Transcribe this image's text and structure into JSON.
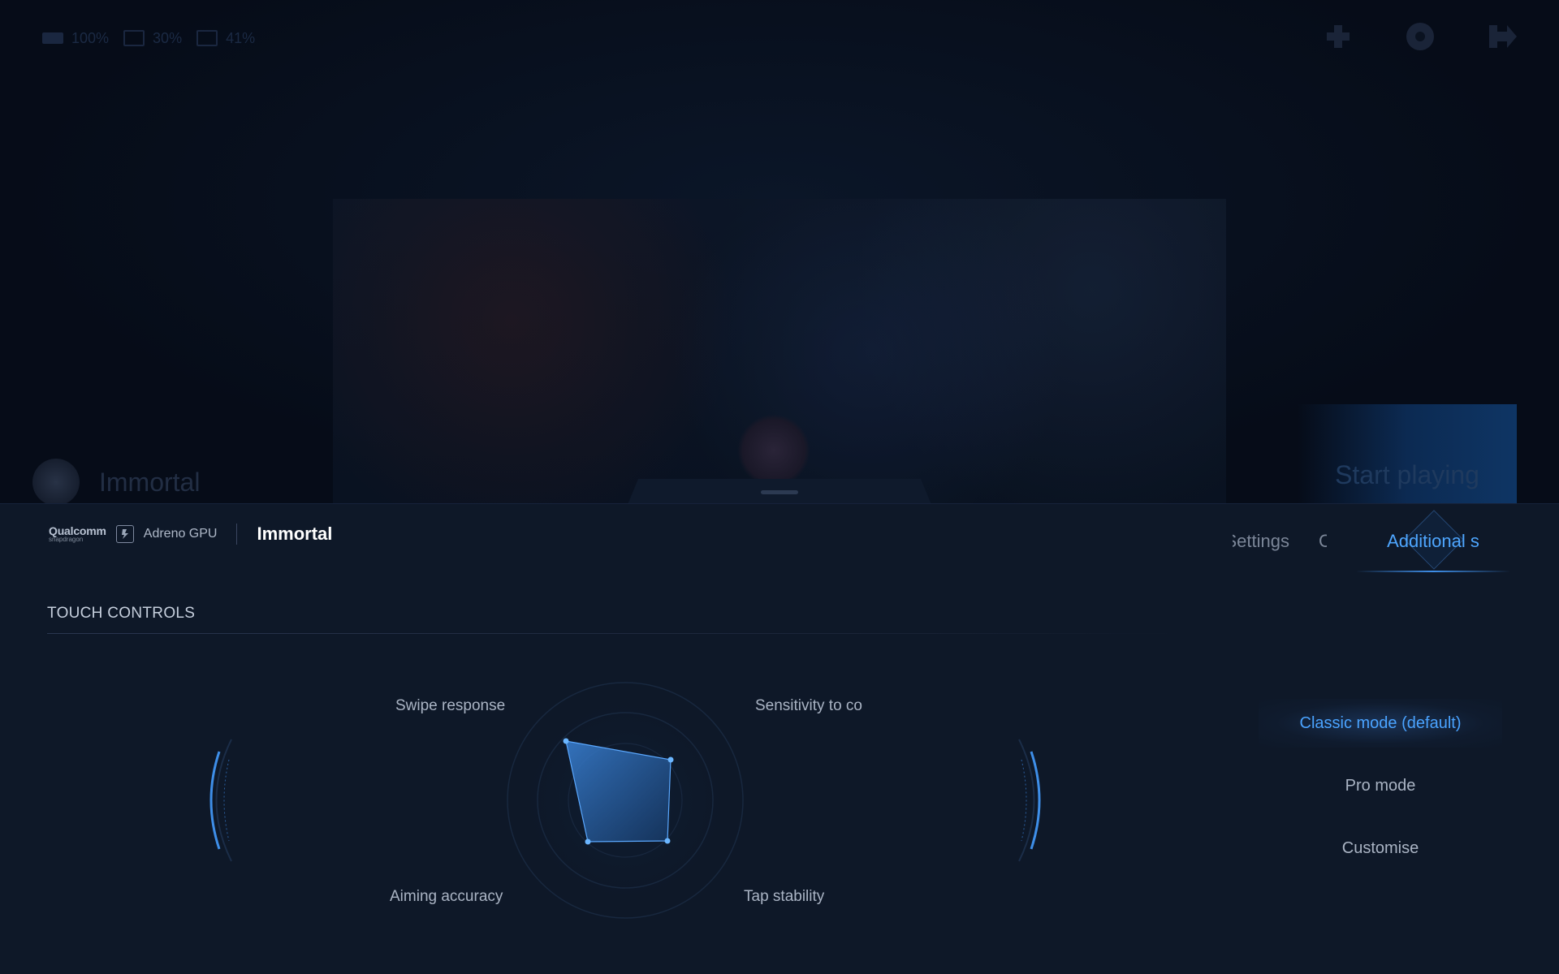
{
  "status_bar": {
    "battery": "100%",
    "cpu": "30%",
    "gpu": "41%"
  },
  "background": {
    "game_title": "Immortal",
    "start_button": "Start playing"
  },
  "panel": {
    "brand": {
      "qualcomm": "Qualcomm",
      "snapdragon": "snapdragon",
      "gpu_label": "Adreno GPU"
    },
    "game_title": "Immortal",
    "tabs": [
      {
        "label": "Settings"
      },
      {
        "label": "C"
      },
      {
        "label": "Additional s"
      }
    ],
    "section_title": "TOUCH CONTROLS",
    "radar": {
      "labels": [
        "Swipe response",
        "Sensitivity to co",
        "Tap stability",
        "Aiming accuracy"
      ]
    },
    "modes": [
      {
        "label": "Classic mode (default)",
        "selected": true
      },
      {
        "label": "Pro mode",
        "selected": false
      },
      {
        "label": "Customise",
        "selected": false
      }
    ]
  },
  "colors": {
    "accent": "#4aa3ff",
    "panel_bg": "#0e1828",
    "page_bg": "#060d1b"
  }
}
